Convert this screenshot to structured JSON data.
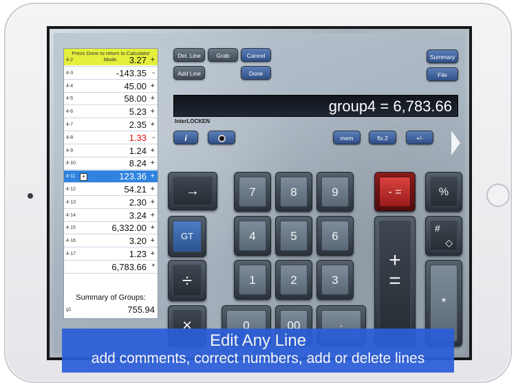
{
  "tape": {
    "tip": "Press Done to return to Calculator Mode.",
    "rows": [
      {
        "label": "4-2",
        "value": "3.27",
        "op": "+"
      },
      {
        "label": "4-3",
        "value": "-143.35",
        "op": "-"
      },
      {
        "label": "4-4",
        "value": "45.00",
        "op": "+"
      },
      {
        "label": "4-5",
        "value": "58.00",
        "op": "+"
      },
      {
        "label": "4-6",
        "value": "5.23",
        "op": "+"
      },
      {
        "label": "4-7",
        "value": "2.35",
        "op": "+"
      },
      {
        "label": "4-8",
        "value": "1.33",
        "op": "-"
      },
      {
        "label": "4-9",
        "value": "1.24",
        "op": "+"
      },
      {
        "label": "4-10",
        "value": "8.24",
        "op": "+"
      },
      {
        "label": "4-11",
        "value": "123.36",
        "op": "+"
      },
      {
        "label": "4-12",
        "value": "54.21",
        "op": "+"
      },
      {
        "label": "4-13",
        "value": "2.30",
        "op": "+"
      },
      {
        "label": "4-14",
        "value": "3.24",
        "op": "+"
      },
      {
        "label": "4-15",
        "value": "6,332.00",
        "op": "+"
      },
      {
        "label": "4-16",
        "value": "3.20",
        "op": "+"
      },
      {
        "label": "4-17",
        "value": "1.23",
        "op": "+"
      },
      {
        "label": "",
        "value": "6,783.66",
        "op": "*"
      }
    ],
    "summary_title": "Summary of Groups:",
    "summary_row": {
      "label": "g1",
      "value": "755.94"
    }
  },
  "buttons": {
    "del_line": "Del. Line",
    "grab": "Grab",
    "cancel": "Cancel",
    "add_line": "Add Line",
    "done": "Done",
    "summary": "Summary",
    "file": "File",
    "mem": "mem",
    "fix2": "fix.2",
    "plus_minus": "+/-"
  },
  "display": {
    "value": "group4 = 6,783.66",
    "brand": "InterLOCKEN"
  },
  "keys": {
    "right_arrow": "→",
    "gt": "GT",
    "divide": "÷",
    "multiply": "×",
    "seven": "7",
    "eight": "8",
    "nine": "9",
    "four": "4",
    "five": "5",
    "six": "6",
    "one": "1",
    "two": "2",
    "three": "3",
    "zero": "0",
    "double_zero": "00",
    "decimal": "·",
    "minus_equals": "- =",
    "percent": "%",
    "hash": "#",
    "diamond": "◇",
    "plus": "+",
    "equals": "=",
    "star": "*"
  },
  "caption": {
    "title": "Edit Any Line",
    "subtitle": "add comments, correct numbers, add or delete lines"
  },
  "colors": {
    "highlight": "#2f83de",
    "negative": "#e01010",
    "tip": "#e4ef3c",
    "caption": "#2b5ed8"
  }
}
